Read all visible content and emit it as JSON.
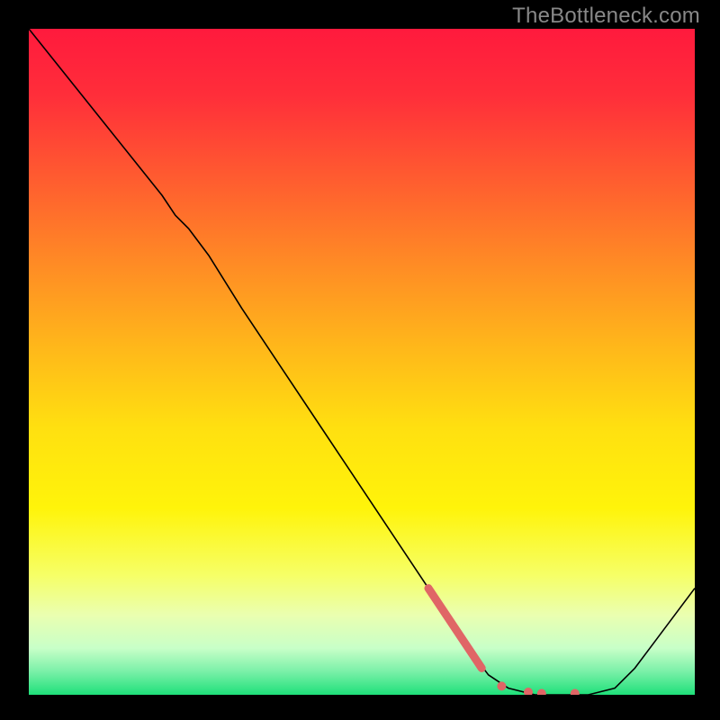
{
  "watermark": "TheBottleneck.com",
  "chart_data": {
    "type": "line",
    "title": "",
    "xlabel": "",
    "ylabel": "",
    "xlim": [
      0,
      100
    ],
    "ylim": [
      0,
      100
    ],
    "grid": false,
    "legend": false,
    "background_gradient": {
      "stops": [
        {
          "offset": 0.0,
          "color": "#ff1a3d"
        },
        {
          "offset": 0.1,
          "color": "#ff2e3a"
        },
        {
          "offset": 0.22,
          "color": "#ff5a30"
        },
        {
          "offset": 0.35,
          "color": "#ff8a25"
        },
        {
          "offset": 0.48,
          "color": "#ffb81a"
        },
        {
          "offset": 0.6,
          "color": "#ffe010"
        },
        {
          "offset": 0.72,
          "color": "#fff40a"
        },
        {
          "offset": 0.82,
          "color": "#f6ff66"
        },
        {
          "offset": 0.88,
          "color": "#eaffb0"
        },
        {
          "offset": 0.93,
          "color": "#c8ffc8"
        },
        {
          "offset": 0.965,
          "color": "#7af0a8"
        },
        {
          "offset": 1.0,
          "color": "#1fe07a"
        }
      ]
    },
    "series": [
      {
        "name": "bottleneck-curve",
        "type": "line",
        "color": "#000000",
        "width": 1.6,
        "points": [
          {
            "x": 0,
            "y": 100
          },
          {
            "x": 4,
            "y": 95
          },
          {
            "x": 8,
            "y": 90
          },
          {
            "x": 12,
            "y": 85
          },
          {
            "x": 16,
            "y": 80
          },
          {
            "x": 20,
            "y": 75
          },
          {
            "x": 22,
            "y": 72
          },
          {
            "x": 24,
            "y": 70
          },
          {
            "x": 27,
            "y": 66
          },
          {
            "x": 32,
            "y": 58
          },
          {
            "x": 38,
            "y": 49
          },
          {
            "x": 44,
            "y": 40
          },
          {
            "x": 50,
            "y": 31
          },
          {
            "x": 56,
            "y": 22
          },
          {
            "x": 62,
            "y": 13
          },
          {
            "x": 66,
            "y": 7
          },
          {
            "x": 69,
            "y": 3
          },
          {
            "x": 72,
            "y": 1
          },
          {
            "x": 76,
            "y": 0
          },
          {
            "x": 80,
            "y": 0
          },
          {
            "x": 84,
            "y": 0
          },
          {
            "x": 88,
            "y": 1
          },
          {
            "x": 91,
            "y": 4
          },
          {
            "x": 94,
            "y": 8
          },
          {
            "x": 97,
            "y": 12
          },
          {
            "x": 100,
            "y": 16
          }
        ]
      },
      {
        "name": "highlight-segment",
        "type": "line",
        "color": "#e06666",
        "width": 9,
        "cap": "round",
        "points": [
          {
            "x": 60,
            "y": 16
          },
          {
            "x": 68,
            "y": 4
          }
        ]
      },
      {
        "name": "highlight-dots",
        "type": "scatter",
        "color": "#e06666",
        "radius": 5,
        "points": [
          {
            "x": 71,
            "y": 1.3
          },
          {
            "x": 75,
            "y": 0.4
          },
          {
            "x": 77,
            "y": 0.2
          },
          {
            "x": 82,
            "y": 0.2
          }
        ]
      }
    ]
  }
}
